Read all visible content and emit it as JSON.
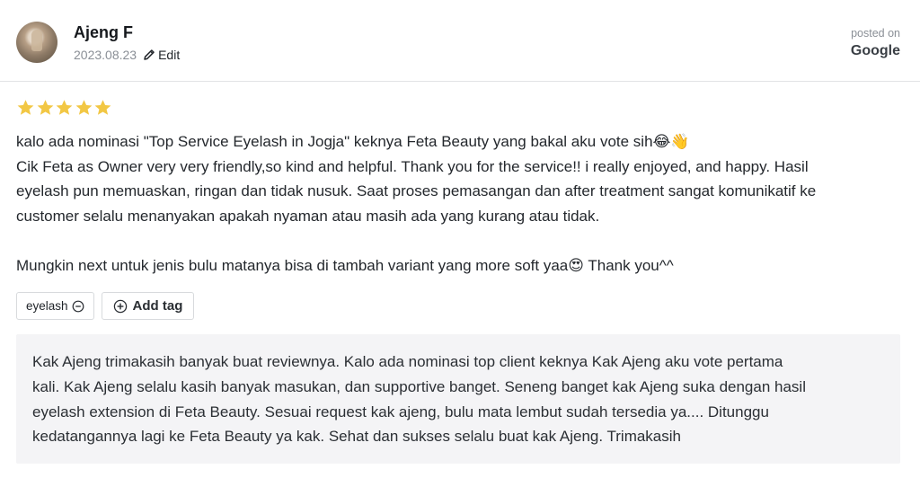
{
  "review": {
    "reviewer_name": "Ajeng F",
    "date": "2023.08.23",
    "edit_label": "Edit",
    "posted_on_label": "posted on",
    "source": "Google",
    "rating": 5,
    "star_color": "#f2c744",
    "text_lines": [
      "kalo ada nominasi \"Top Service Eyelash in Jogja\" keknya Feta Beauty yang bakal aku vote sih😂👋",
      "Cik Feta as Owner very very friendly,so kind and helpful. Thank you for the service!! i really enjoyed, and happy. Hasil",
      "eyelash pun memuaskan, ringan dan tidak nusuk. Saat proses pemasangan dan after treatment sangat komunikatif ke",
      "customer selalu menanyakan apakah nyaman atau masih ada yang kurang atau tidak.",
      "",
      "Mungkin next untuk jenis bulu matanya bisa di tambah variant yang more soft yaa😍 Thank you^^"
    ]
  },
  "tags": {
    "items": [
      {
        "label": "eyelash",
        "icon": "minus-circle-icon"
      }
    ],
    "add_label": "Add tag",
    "add_icon": "plus-circle-icon"
  },
  "reply": {
    "lines": [
      "Kak Ajeng trimakasih banyak buat reviewnya. Kalo ada nominasi top client keknya Kak Ajeng aku vote pertama",
      "kali. Kak Ajeng selalu kasih banyak masukan, dan supportive banget. Seneng banget kak Ajeng suka dengan hasil",
      "eyelash extension di Feta Beauty. Sesuai request kak ajeng, bulu mata lembut sudah tersedia ya.... Ditunggu",
      "kedatangannya lagi ke Feta Beauty ya kak. Sehat dan sukses selalu buat kak Ajeng. Trimakasih"
    ]
  }
}
